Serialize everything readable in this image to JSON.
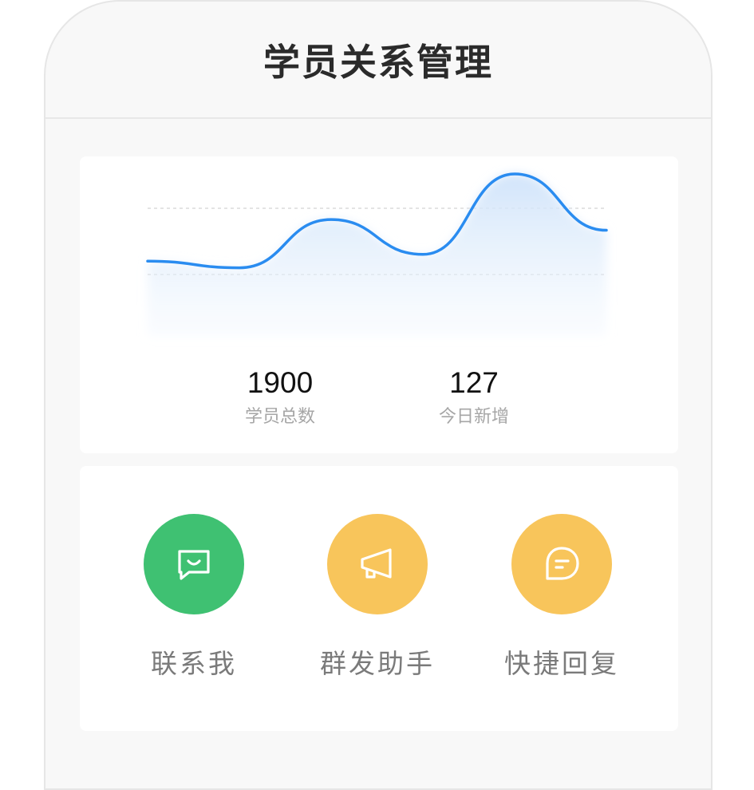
{
  "header": {
    "title": "学员关系管理"
  },
  "stats": {
    "total": {
      "value": "1900",
      "label": "学员总数"
    },
    "new_today": {
      "value": "127",
      "label": "今日新增"
    }
  },
  "chart_data": {
    "type": "area",
    "title": "",
    "xlabel": "",
    "ylabel": "",
    "grid": true,
    "series": [
      {
        "values": [
          0.35,
          0.3,
          0.66,
          0.4,
          1.0,
          0.58
        ]
      }
    ],
    "color": "#2a8cf0",
    "fill": "#dcebfb"
  },
  "actions": [
    {
      "label": "联系我",
      "icon": "chat-smile-icon",
      "color": "#3fc172"
    },
    {
      "label": "群发助手",
      "icon": "megaphone-icon",
      "color": "#f8c55b"
    },
    {
      "label": "快捷回复",
      "icon": "speech-bubble-icon",
      "color": "#f8c55b"
    }
  ]
}
